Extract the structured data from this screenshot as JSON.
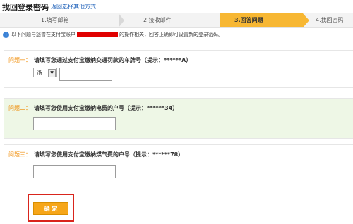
{
  "header": {
    "title": "找回登录密码",
    "back_link": "返回选择其他方式"
  },
  "steps": [
    {
      "label": "1.填写邮箱"
    },
    {
      "label": "2.接收邮件"
    },
    {
      "label": "3.回答问题",
      "active": true
    },
    {
      "label": "4.找回密码"
    }
  ],
  "notice": {
    "before": "以下问题与您曾在支付宝账户",
    "after": "的操作相关，回答正确即可设置新的登录密码。"
  },
  "questions": [
    {
      "label": "问题一：",
      "text": "请填写您通过支付宝缴纳交通罚款的车牌号（提示：******A）",
      "plate_value": "浙"
    },
    {
      "label": "问题二：",
      "text": "请填写您使用支付宝缴纳电费的户号（提示：******34）"
    },
    {
      "label": "问题三：",
      "text": "请填写您使用支付宝缴纳煤气费的户号（提示：******78）"
    }
  ],
  "confirm_label": "确 定",
  "colors": {
    "accent": "#f7b733",
    "question_label": "#f08a00",
    "highlight_border": "#d9251d",
    "link": "#1a5eb8"
  }
}
